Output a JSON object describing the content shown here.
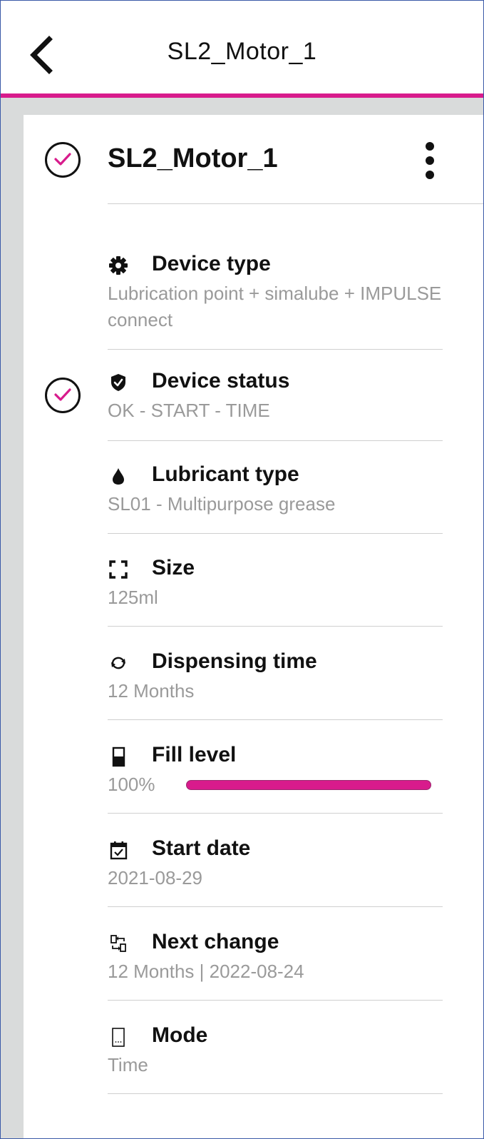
{
  "header": {
    "title": "SL2_Motor_1"
  },
  "device": {
    "name": "SL2_Motor_1",
    "status_ok": true
  },
  "details": {
    "device_type": {
      "label": "Device type",
      "value": "Lubrication point + simalube + IMPULSE connect",
      "icon": "gear-icon"
    },
    "device_status": {
      "label": "Device status",
      "value": "OK - START - TIME",
      "icon": "shield-check-icon"
    },
    "lubricant_type": {
      "label": "Lubricant type",
      "value": "SL01 - Multipurpose grease",
      "icon": "drop-icon"
    },
    "size": {
      "label": "Size",
      "value": "125ml",
      "icon": "expand-icon"
    },
    "dispensing_time": {
      "label": "Dispensing time",
      "value": "12 Months",
      "icon": "cycle-icon"
    },
    "fill_level": {
      "label": "Fill level",
      "value": "100%",
      "level": 1.0,
      "icon": "battery-icon"
    },
    "start_date": {
      "label": "Start date",
      "value": "2021-08-29",
      "icon": "calendar-check-icon"
    },
    "next_change": {
      "label": "Next change",
      "value": "12 Months | 2022-08-24",
      "icon": "swap-icon"
    },
    "mode": {
      "label": "Mode",
      "value": "Time",
      "icon": "mode-device-icon"
    }
  },
  "colors": {
    "accent": "#d81b8c",
    "background": "#d9dbdb",
    "value_text": "#9a9a9a"
  }
}
